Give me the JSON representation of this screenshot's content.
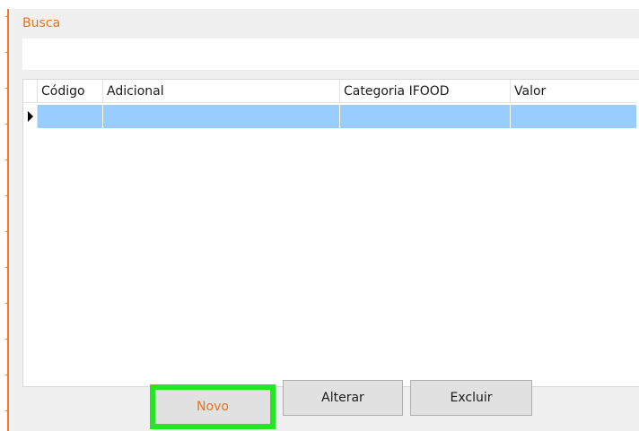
{
  "search": {
    "label": "Busca",
    "value": "",
    "placeholder": ""
  },
  "grid": {
    "columns": [
      "Código",
      "Adicional",
      "Categoria IFOOD",
      "Valor"
    ],
    "rows": [
      {
        "codigo": "",
        "adicional": "",
        "categoria": "",
        "valor": ""
      }
    ]
  },
  "buttons": {
    "novo": "Novo",
    "alterar": "Alterar",
    "excluir": "Excluir"
  },
  "colors": {
    "accent": "#e8731f",
    "selection": "#99ccff",
    "highlight": "#22e822"
  }
}
